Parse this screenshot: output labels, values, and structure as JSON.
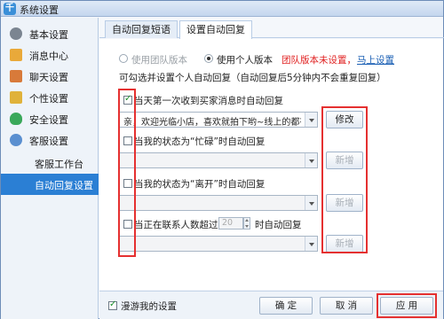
{
  "window": {
    "title": "系统设置",
    "app_icon": "qianniu-app-icon"
  },
  "sidebar": {
    "items": [
      {
        "label": "基本设置",
        "icon": "gear-icon",
        "color": "#7b8591"
      },
      {
        "label": "消息中心",
        "icon": "mail-icon",
        "color": "#e9a93a"
      },
      {
        "label": "聊天设置",
        "icon": "chat-icon",
        "color": "#d87a3a"
      },
      {
        "label": "个性设置",
        "icon": "palette-icon",
        "color": "#e0b23a"
      },
      {
        "label": "安全设置",
        "icon": "shield-icon",
        "color": "#3aa85a"
      },
      {
        "label": "客服设置",
        "icon": "headset-icon",
        "color": "#5a8fd0"
      }
    ],
    "sub_items": [
      {
        "label": "客服工作台"
      },
      {
        "label": "自动回复设置"
      }
    ]
  },
  "tabs": [
    {
      "label": "自动回复短语"
    },
    {
      "label": "设置自动回复"
    }
  ],
  "mode": {
    "team_label": "使用团队版本",
    "personal_label": "使用个人版本",
    "team_notice": "团队版本未设置，",
    "setup_link": "马上设置"
  },
  "hint": "可勾选并设置个人自动回复（自动回复后5分钟内不会重复回复）",
  "rules": {
    "r1_label": "当天第一次收到买家消息时自动回复",
    "r1_value": "亲，欢迎光临小店，喜欢就拍下哟~线上的都有",
    "r1_button": "修改",
    "r2_label": "当我的状态为“忙碌”时自动回复",
    "r2_button": "新增",
    "r3_label": "当我的状态为“离开”时自动回复",
    "r3_button": "新增",
    "r4_label_before": "当正在联系人数超过",
    "r4_count": "20",
    "r4_label_after": "时自动回复",
    "r4_button": "新增"
  },
  "footer": {
    "roaming_label": "漫游我的设置",
    "ok": "确 定",
    "cancel": "取 消",
    "apply": "应 用"
  },
  "colors": {
    "accent": "#2b7fd4",
    "annotation": "#e53030",
    "warning": "#e02020"
  }
}
